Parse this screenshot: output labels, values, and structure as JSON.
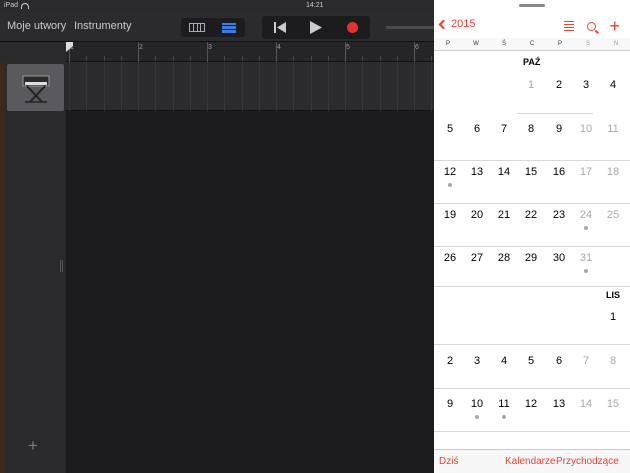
{
  "status": {
    "device": "iPad",
    "time": "14:21"
  },
  "toolbar": {
    "my_songs": "Moje utwory",
    "instruments": "Instrumenty"
  },
  "ruler": {
    "bars": [
      "1",
      "2",
      "3",
      "4",
      "5",
      "6"
    ]
  },
  "calendar": {
    "back_label": "2015",
    "weekdays": [
      "P",
      "W",
      "Ś",
      "C",
      "P",
      "S",
      "N"
    ],
    "oct_label": "PAŹ",
    "nov_label": "LIS",
    "oct_week1": [
      "1",
      "2",
      "3",
      "4"
    ],
    "oct_week2": [
      "5",
      "6",
      "7",
      "8",
      "9",
      "10",
      "11"
    ],
    "oct_week3": [
      "12",
      "13",
      "14",
      "15",
      "16",
      "17",
      "18"
    ],
    "oct_week4": [
      "19",
      "20",
      "21",
      "22",
      "23",
      "24",
      "25"
    ],
    "oct_week5": [
      "26",
      "27",
      "28",
      "29",
      "30",
      "31"
    ],
    "nov_week1": [
      "1"
    ],
    "nov_week2": [
      "2",
      "3",
      "4",
      "5",
      "6",
      "7",
      "8"
    ],
    "nov_week3": [
      "9",
      "10",
      "11",
      "12",
      "13",
      "14",
      "15"
    ],
    "footer": {
      "today": "Dziś",
      "calendars": "Kalendarze",
      "inbox": "Przychodzące"
    },
    "accent": "#f23d31"
  }
}
